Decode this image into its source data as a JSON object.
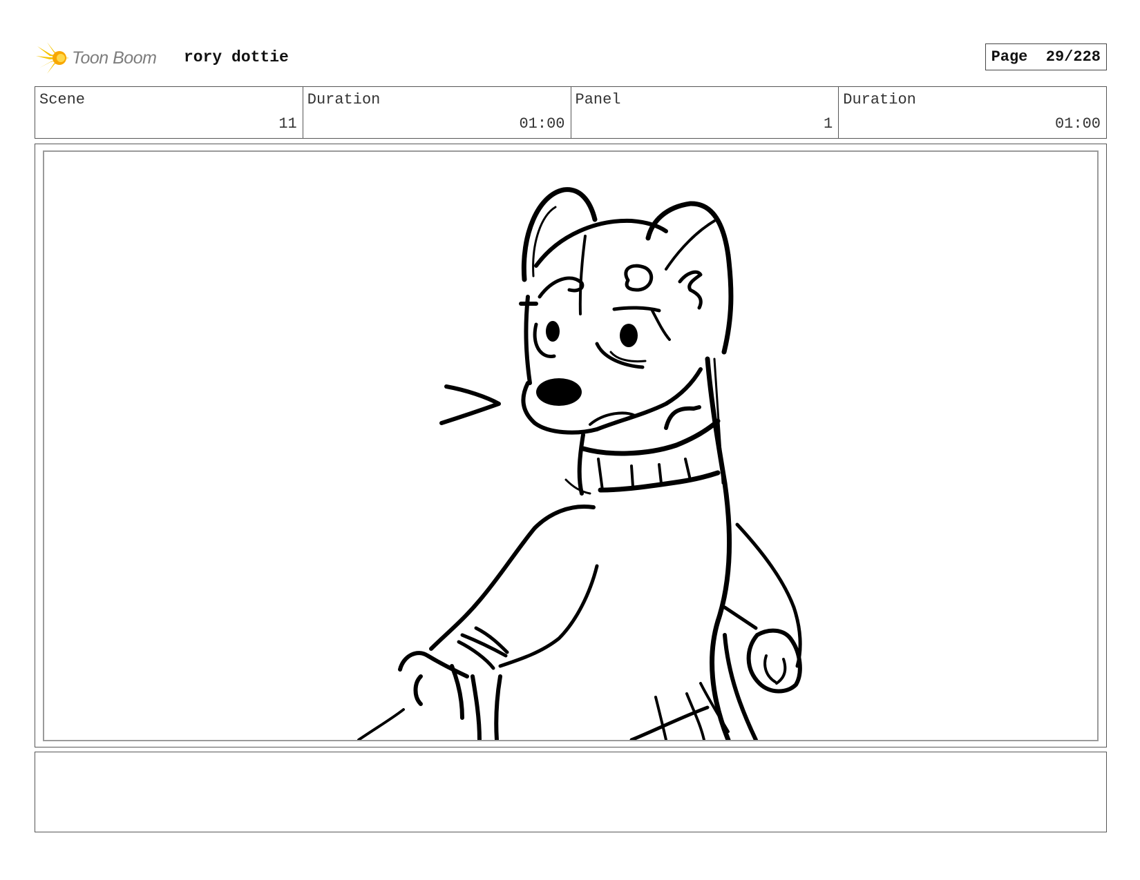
{
  "header": {
    "logo_text": "Toon Boom",
    "logo_icon": "star-burst-icon",
    "project_title": "rory dottie",
    "page_label": "Page",
    "page_value": "29/228"
  },
  "info": {
    "scene_label": "Scene",
    "scene_value": "11",
    "scene_duration_label": "Duration",
    "scene_duration_value": "01:00",
    "panel_label": "Panel",
    "panel_value": "1",
    "panel_duration_label": "Duration",
    "panel_duration_value": "01:00"
  },
  "panel": {
    "image": "storyboard-sketch",
    "notes": ""
  },
  "colors": {
    "logo_yellow": "#f5c400",
    "logo_text": "#7d7d7d",
    "border": "#555555"
  }
}
